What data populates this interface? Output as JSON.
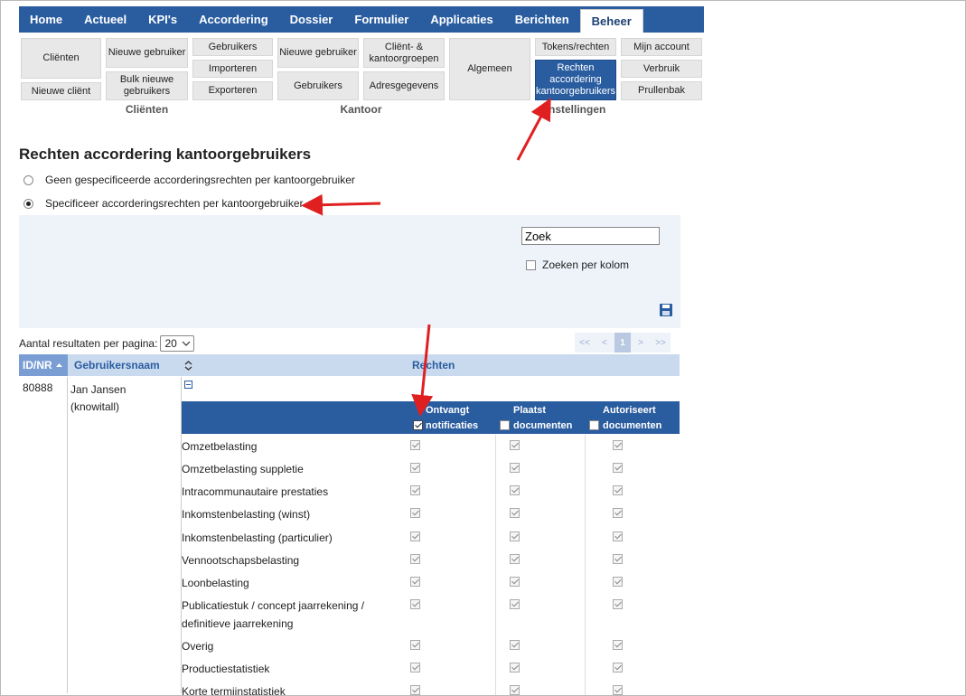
{
  "nav": {
    "items": [
      "Home",
      "Actueel",
      "KPI's",
      "Accordering",
      "Dossier",
      "Formulier",
      "Applicaties",
      "Berichten",
      "Beheer"
    ],
    "active": "Beheer"
  },
  "ribbon": {
    "clienten_group": {
      "label": "Cliënten",
      "buttons": [
        "Cliënten",
        "Nieuwe cliënt",
        "Nieuwe gebruiker",
        "Bulk nieuwe gebruikers",
        "Gebruikers",
        "Importeren",
        "Exporteren"
      ]
    },
    "kantoor_group": {
      "label": "Kantoor",
      "buttons": [
        "Nieuwe gebruiker",
        "Gebruikers",
        "Cliënt- & kantoorgroepen",
        "Adresgegevens"
      ]
    },
    "instellingen_group": {
      "label": "Instellingen",
      "buttons": [
        "Algemeen",
        "Tokens/rechten",
        "Rechten accordering kantoorgebruikers",
        "Mijn account",
        "Verbruik",
        "Prullenbak"
      ]
    }
  },
  "page": {
    "title": "Rechten accordering kantoorgebruikers",
    "option_none": "Geen gespecificeerde accorderingsrechten per kantoorgebruiker",
    "option_specify": "Specificeer accorderingsrechten per kantoorgebruiker",
    "selected_option": "specify"
  },
  "filter": {
    "search_value": "Zoek",
    "search_per_column": "Zoeken per kolom"
  },
  "paging": {
    "per_page_label": "Aantal resultaten per pagina:",
    "per_page_value": "20",
    "buttons": [
      "<<",
      "<",
      "1",
      ">",
      ">>"
    ],
    "current": "1"
  },
  "table": {
    "headers": [
      "ID/NR",
      "Gebruikersnaam",
      "Rechten"
    ],
    "row": {
      "id": "80888",
      "name": "Jan Jansen",
      "username": "(knowitall)"
    },
    "rights_columns": [
      {
        "line1": "Ontvangt",
        "line2": "notificaties",
        "checked": true
      },
      {
        "line1": "Plaatst",
        "line2": "documenten",
        "checked": false
      },
      {
        "line1": "Autoriseert",
        "line2": "documenten",
        "checked": false
      }
    ],
    "permissions": [
      "Omzetbelasting",
      "Omzetbelasting suppletie",
      "Intracommunautaire prestaties",
      "Inkomstenbelasting (winst)",
      "Inkomstenbelasting (particulier)",
      "Vennootschapsbelasting",
      "Loonbelasting",
      "Publicatiestuk / concept jaarrekening / definitieve jaarrekening",
      "Overig",
      "Productiestatistiek",
      "Korte termijnstatistiek"
    ]
  },
  "colors": {
    "nav_blue": "#2a5da0",
    "highlight_arrow": "#e02020"
  }
}
